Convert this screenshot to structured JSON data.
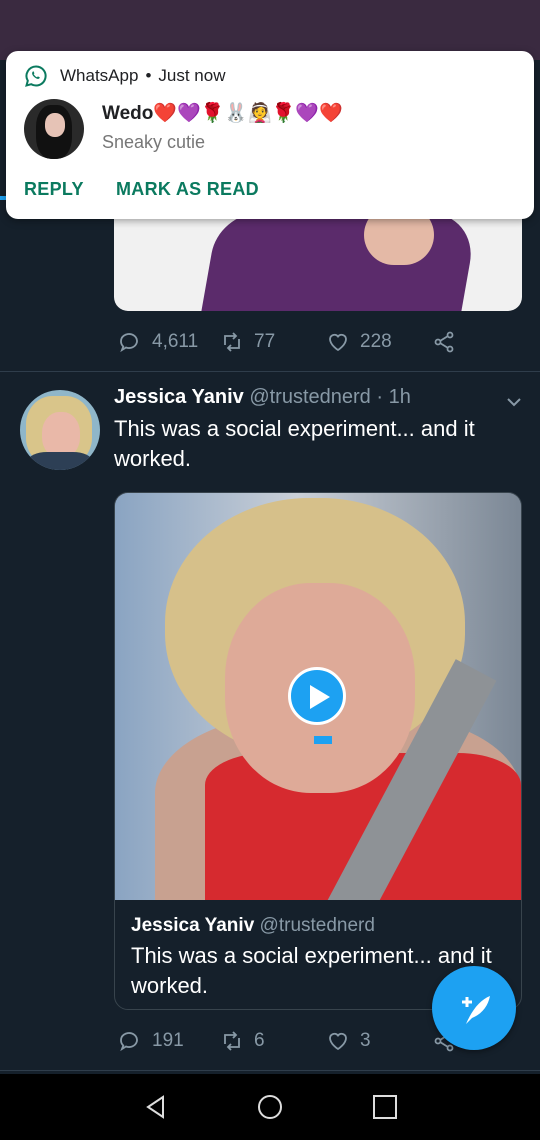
{
  "notification": {
    "app_name": "WhatsApp",
    "time": "Just now",
    "separator": "•",
    "title": "Wedo❤️💜🌹🐰👰🌹💜❤️",
    "message": "Sneaky cutie",
    "reply_label": "REPLY",
    "mark_read_label": "MARK AS READ"
  },
  "tweet1": {
    "replies": "4,611",
    "retweets": "77",
    "likes": "228"
  },
  "tweet2": {
    "name": "Jessica Yaniv",
    "handle": "@trustednerd",
    "time": "· 1h",
    "text": "This was a social experiment... and it worked.",
    "quoted": {
      "name": "Jessica Yaniv",
      "handle": "@trustednerd",
      "text": "This was a social experiment... and it worked."
    },
    "replies": "191",
    "retweets": "6",
    "likes": "3"
  },
  "colors": {
    "background": "#15202b",
    "accent": "#1da1f2",
    "whatsapp_green": "#0b7a5f",
    "muted": "#8899a6"
  }
}
